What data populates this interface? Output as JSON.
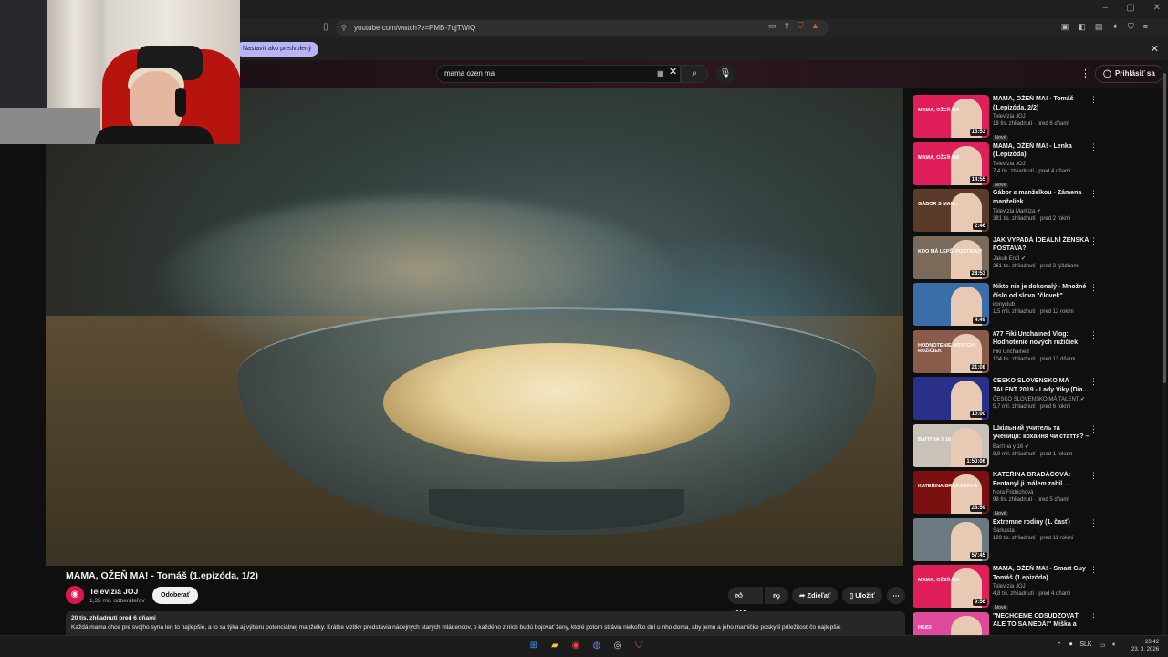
{
  "browser": {
    "url": "youtube.com/watch?v=PMB-7qjTWiQ",
    "infobar_text": "Nastaviť ako predvolený",
    "window_controls": [
      "–",
      "▢",
      "✕"
    ]
  },
  "masthead": {
    "search_value": "mama ozen ma",
    "signin_label": "Prihlásiť sa"
  },
  "video": {
    "title": "MAMA, OŽEŇ MA! - Tomáš (1.epizóda, 1/2)",
    "channel_name": "Televízia JOJ",
    "channel_subs": "1,35 mil. odberateľov",
    "subscribe_label": "Odoberať",
    "likes": "116",
    "share_label": "Zdieľať",
    "save_label": "Uložiť",
    "stats": "20 tis. zhliadnutí  pred 6 dňami",
    "description": "Každá mama chce pre svojho syna len to najlepšie, a to sa týka aj výberu potenciálnej manželky. Krátke vizitky predstavia nádejných starých mládencov, o každého z nich budú bojovať ženy, ktoré potom strávia niekoľko dní u nho doma, aby jemu a jeho mamičke poskytli príležitosť čo najlepšie"
  },
  "recommendations": [
    {
      "title": "MAMA, OŽEŇ MA! - Tomáš (1.epizóda, 2/2)",
      "channel": "Televízia JOJ",
      "meta": "18 tis. zhliadnutí · pred 6 dňami",
      "badge": "Nové",
      "duration": "15:53",
      "thumb_label": "MAMA, OŽEŇ MA",
      "thumb_color": "#e01e5a",
      "verified": false
    },
    {
      "title": "MAMA, OŽEŇ MA! - Lenka (1.epizóda)",
      "channel": "Televízia JOJ",
      "meta": "7,4 tis. zhliadnutí · pred 4 dňami",
      "badge": "Nové",
      "duration": "14:55",
      "thumb_label": "MAMA, OŽEŇ MA",
      "thumb_color": "#e01e5a",
      "verified": false
    },
    {
      "title": "Gábor s manželkou - Zámena manželiek",
      "channel": "Televízia Markíza",
      "meta": "381 tis. zhliadnutí · pred 2 rokmi",
      "badge": "",
      "duration": "2:46",
      "thumb_label": "GÁBOR S MAN...",
      "thumb_color": "#5a3b2a",
      "verified": true
    },
    {
      "title": "JAK VYPADÁ IDEÁLNÍ ŽENSKÁ POSTAVA?",
      "channel": "Jakub Enžl",
      "meta": "261 tis. zhliadnutí · pred 3 týždňami",
      "badge": "",
      "duration": "28:53",
      "thumb_label": "KDO MÁ LEPŠÍ POSTAVU?",
      "thumb_color": "#7a6a5a",
      "verified": true
    },
    {
      "title": "Nikto nie je dokonalý - Množné číslo od slova \"človek\"",
      "channel": "ironyclub",
      "meta": "1,5 mil. zhliadnutí · pred 12 rokmi",
      "badge": "",
      "duration": "4:49",
      "thumb_label": "",
      "thumb_color": "#3a6ea8",
      "verified": false
    },
    {
      "title": "#77 Fiki Unchained Vlog: Hodnotenie nových ružičiek",
      "channel": "Fiki Unchained",
      "meta": "104 tis. zhliadnutí · pred 13 dňami",
      "badge": "",
      "duration": "21:08",
      "thumb_label": "HODNOTENIE NOVÝCH RUŽIČIEK",
      "thumb_color": "#8a5a4a",
      "verified": false
    },
    {
      "title": "ČESKO SLOVENSKO MÁ TALENT 2019 - Lady Viky (Dia...",
      "channel": "ČESKO SLOVENSKO MÁ TALENT",
      "meta": "5,7 mil. zhliadnutí · pred 6 rokmi",
      "badge": "",
      "duration": "10:00",
      "thumb_label": "",
      "thumb_color": "#2a2f8a",
      "verified": true
    },
    {
      "title": "Шкільний учитель та учениця: кохання чи стаття? – Вагітна...",
      "channel": "Вагітна у 16",
      "meta": "8,9 mil. zhliadnutí · pred 1 rokom",
      "badge": "",
      "duration": "1:50:06",
      "thumb_label": "ВАГІТНА У 16",
      "thumb_color": "#c9c2b8",
      "verified": true
    },
    {
      "title": "KATEŘINA BRADÁČOVÁ: Fentanyl ji málem zabil. ...",
      "channel": "Nora Fridrichová",
      "meta": "98 tis. zhliadnutí · pred 5 dňami",
      "badge": "Nové",
      "duration": "28:59",
      "thumb_label": "KATEŘINA BRADÁČOVÁ",
      "thumb_color": "#7a1010",
      "verified": false
    },
    {
      "title": "Extremne rodiny (1. časť)",
      "channel": "Sarkasta",
      "meta": "199 tis. zhliadnutí · pred 11 rokmi",
      "badge": "",
      "duration": "57:45",
      "thumb_label": "",
      "thumb_color": "#6b7a80",
      "verified": false
    },
    {
      "title": "MAMA, OŽEŇ MA! - Smart Guy Tomáš (1.epizóda)",
      "channel": "Televízia JOJ",
      "meta": "4,8 tis. zhliadnutí · pred 4 dňami",
      "badge": "Nové",
      "duration": "9:56",
      "thumb_label": "MAMA, OŽEŇ MA",
      "thumb_color": "#e01e5a",
      "verified": false
    },
    {
      "title": "\"NECHCEME ODSUDZOVAŤ ALE TO SA NEDÁ!\" Miška a Heidi z ...",
      "channel": "",
      "meta": "",
      "badge": "",
      "duration": "",
      "thumb_label": "HEIDI",
      "thumb_color": "#e04a9a",
      "verified": false
    }
  ],
  "taskbar": {
    "lang": "SLK",
    "time": "23:42",
    "date": "23. 3. 2026"
  }
}
